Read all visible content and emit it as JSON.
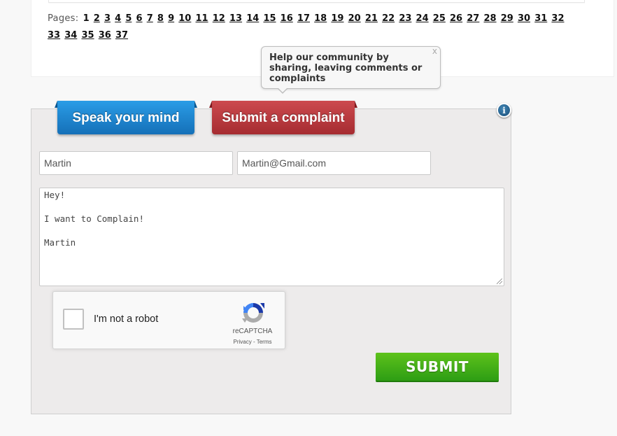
{
  "pagination": {
    "label": "Pages:",
    "current": "1",
    "pages": [
      "1",
      "2",
      "3",
      "4",
      "5",
      "6",
      "7",
      "8",
      "9",
      "10",
      "11",
      "12",
      "13",
      "14",
      "15",
      "16",
      "17",
      "18",
      "19",
      "20",
      "21",
      "22",
      "23",
      "24",
      "25",
      "26",
      "27",
      "28",
      "29",
      "30",
      "31",
      "32",
      "33",
      "34",
      "35",
      "36",
      "37"
    ]
  },
  "tooltip": {
    "text": "Help our community by sharing, leaving comments or complaints",
    "close_label": "x"
  },
  "tabs": [
    {
      "label": "Speak your mind",
      "color": "#1b84d0"
    },
    {
      "label": "Submit a complaint",
      "color": "#b8383d"
    }
  ],
  "info_icon": {
    "glyph": "i"
  },
  "form": {
    "name_value": "Martin",
    "email_value": "Martin@Gmail.com",
    "message_value": "Hey!\n\nI want to Complain!\n\nMartin"
  },
  "recaptcha": {
    "label": "I'm not a robot",
    "brand": "reCAPTCHA",
    "privacy": "Privacy",
    "separator": " - ",
    "terms": "Terms"
  },
  "submit": {
    "label": "SUBMIT",
    "color": "#3aab16"
  }
}
